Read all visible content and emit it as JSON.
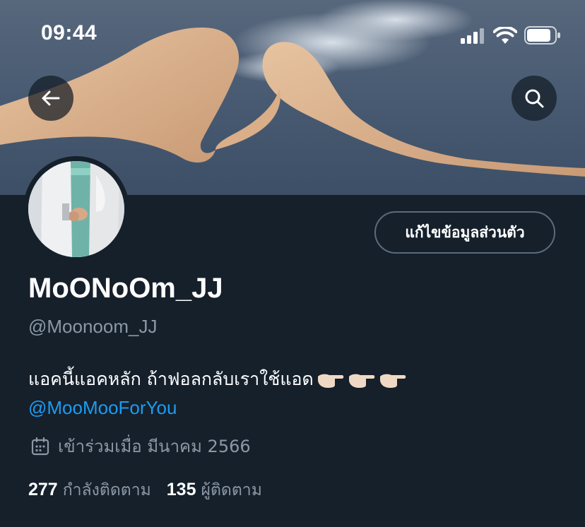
{
  "status_bar": {
    "time": "09:44",
    "battery_icon": "battery-icon",
    "wifi_icon": "wifi-icon",
    "signal_icon": "cellular-signal-icon"
  },
  "header": {
    "back_icon": "arrow-left-icon",
    "search_icon": "search-icon"
  },
  "profile": {
    "display_name": "MoONoOm_JJ",
    "handle": "@Moonoom_JJ",
    "edit_button_label": "แก้ไขข้อมูลส่วนตัว",
    "bio_text": "แอคนี้แอคหลัก ถ้าฟอลกลับเราใช้แอด",
    "bio_mention": "@MooMooForYou",
    "joined_text": "เข้าร่วมเมื่อ มีนาคม 2566",
    "following_count": "277",
    "following_label": "กำลังติดตาม",
    "followers_count": "135",
    "followers_label": "ผู้ติดตาม"
  },
  "colors": {
    "background": "#15202b",
    "accent": "#1d9bf0",
    "secondary_text": "#8b98a5"
  }
}
